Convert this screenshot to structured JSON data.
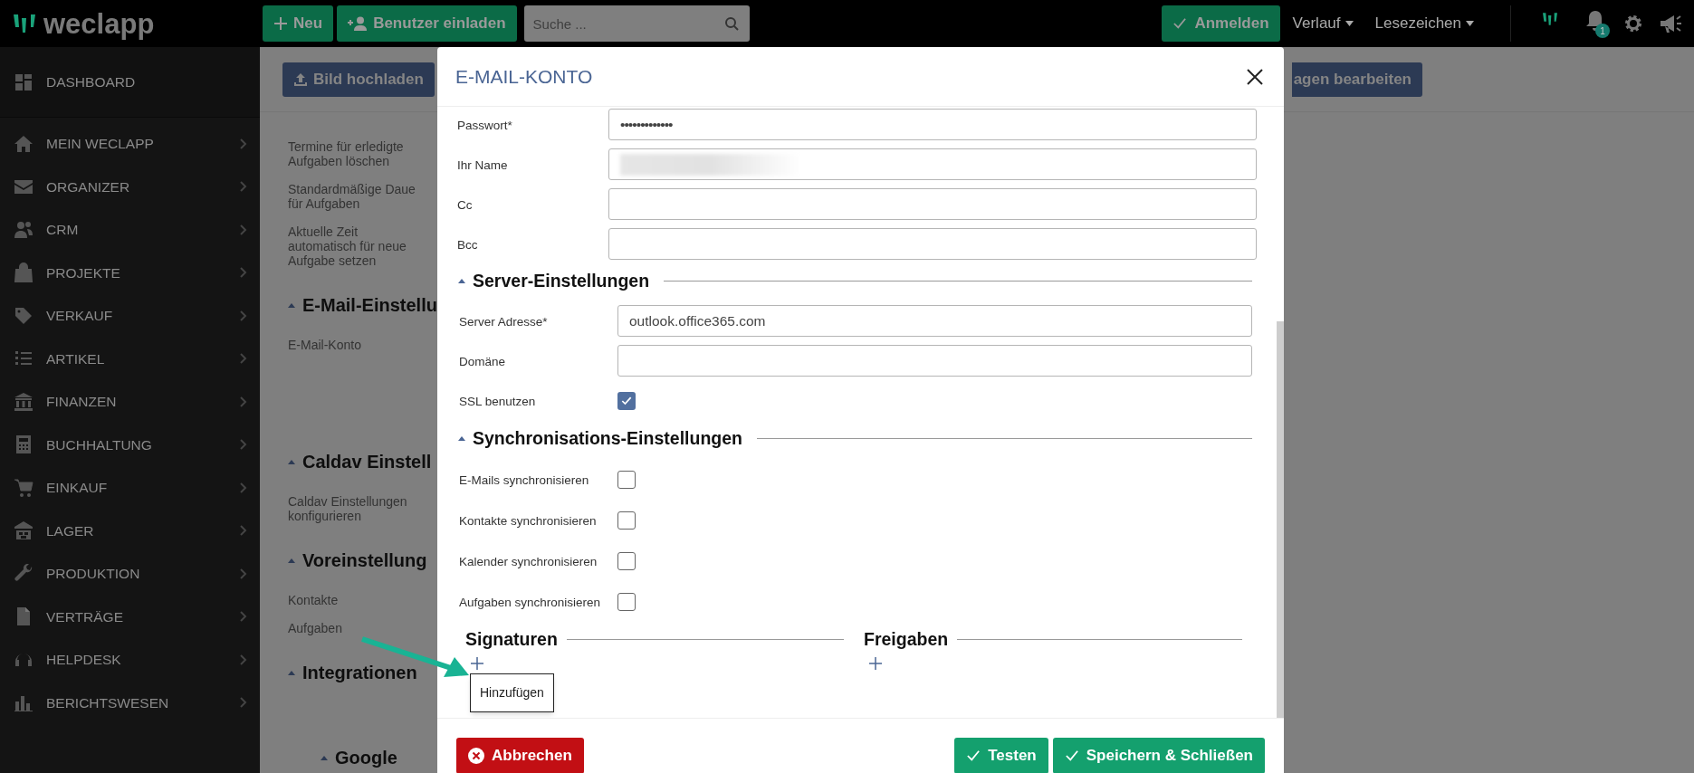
{
  "top_bar": {
    "logo": "weclapp",
    "new_button": "Neu",
    "invite_button": "Benutzer einladen",
    "search": {
      "placeholder": "Suche ..."
    },
    "login_button": "Anmelden",
    "menus": [
      "Verlauf",
      "Lesezeichen"
    ],
    "notification_count": "1"
  },
  "sidebar": {
    "items": [
      {
        "label": "DASHBOARD",
        "has_submenu": false
      },
      {
        "label": "MEIN WECLAPP",
        "has_submenu": true
      },
      {
        "label": "ORGANIZER",
        "has_submenu": true
      },
      {
        "label": "CRM",
        "has_submenu": true
      },
      {
        "label": "PROJEKTE",
        "has_submenu": true
      },
      {
        "label": "VERKAUF",
        "has_submenu": true
      },
      {
        "label": "ARTIKEL",
        "has_submenu": true
      },
      {
        "label": "FINANZEN",
        "has_submenu": true
      },
      {
        "label": "BUCHHALTUNG",
        "has_submenu": true
      },
      {
        "label": "EINKAUF",
        "has_submenu": true
      },
      {
        "label": "LAGER",
        "has_submenu": true
      },
      {
        "label": "PRODUKTION",
        "has_submenu": true
      },
      {
        "label": "VERTRÄGE",
        "has_submenu": true
      },
      {
        "label": "HELPDESK",
        "has_submenu": true
      },
      {
        "label": "BERICHTSWESEN",
        "has_submenu": true
      }
    ]
  },
  "background_page": {
    "upload_button": "Bild hochladen",
    "edit_button": "agen bearbeiten",
    "content": [
      {
        "kind": "label",
        "text": "Termine für erledigte Aufgaben löschen"
      },
      {
        "kind": "label",
        "text": "Standardmäßige Daue für Aufgaben"
      },
      {
        "kind": "label",
        "text": "Aktuelle Zeit automatisch für neue Aufgabe setzen"
      },
      {
        "kind": "heading",
        "text": "E-Mail-Einstellu"
      },
      {
        "kind": "label",
        "text": "E-Mail-Konto"
      },
      {
        "kind": "heading",
        "text": "Caldav Einstell"
      },
      {
        "kind": "label",
        "text": "Caldav Einstellungen konfigurieren"
      },
      {
        "kind": "heading",
        "text": "Voreinstellung"
      },
      {
        "kind": "label",
        "text": "Kontakte"
      },
      {
        "kind": "label",
        "text": "Aufgaben"
      },
      {
        "kind": "heading",
        "text": "Integrationen"
      },
      {
        "kind": "subheading",
        "text": "Google"
      }
    ]
  },
  "dialog": {
    "title": "E-MAIL-KONTO",
    "fields": [
      {
        "kind": "text",
        "label": "Passwort*",
        "value": "•••••••••••••"
      },
      {
        "kind": "blurred",
        "label": "Ihr Name"
      },
      {
        "kind": "text",
        "label": "Cc"
      },
      {
        "kind": "text",
        "label": "Bcc"
      }
    ],
    "sections": [
      {
        "title": "Server-Einstellungen",
        "fields": [
          {
            "kind": "text",
            "label": "Server Adresse*",
            "value": "outlook.office365.com"
          },
          {
            "kind": "text",
            "label": "Domäne"
          },
          {
            "kind": "checkbox",
            "label": "SSL benutzen",
            "checked": true
          }
        ]
      },
      {
        "title": "Synchronisations-Einstellungen",
        "fields": [
          {
            "kind": "checkbox",
            "label": "E-Mails synchronisieren",
            "checked": false
          },
          {
            "kind": "checkbox",
            "label": "Kontakte synchronisieren",
            "checked": false
          },
          {
            "kind": "checkbox",
            "label": "Kalender synchronisieren",
            "checked": false
          },
          {
            "kind": "checkbox",
            "label": "Aufgaben synchronisieren",
            "checked": false
          }
        ]
      }
    ],
    "signatures": {
      "title": "Signaturen",
      "add_tooltip": "Hinzufügen"
    },
    "shares": {
      "title": "Freigaben"
    },
    "footer_buttons": [
      {
        "kind": "cancel",
        "label": "Abbrechen"
      },
      {
        "kind": "confirm",
        "label": "Testen"
      },
      {
        "kind": "confirm",
        "label": "Speichern & Schließen"
      }
    ]
  }
}
